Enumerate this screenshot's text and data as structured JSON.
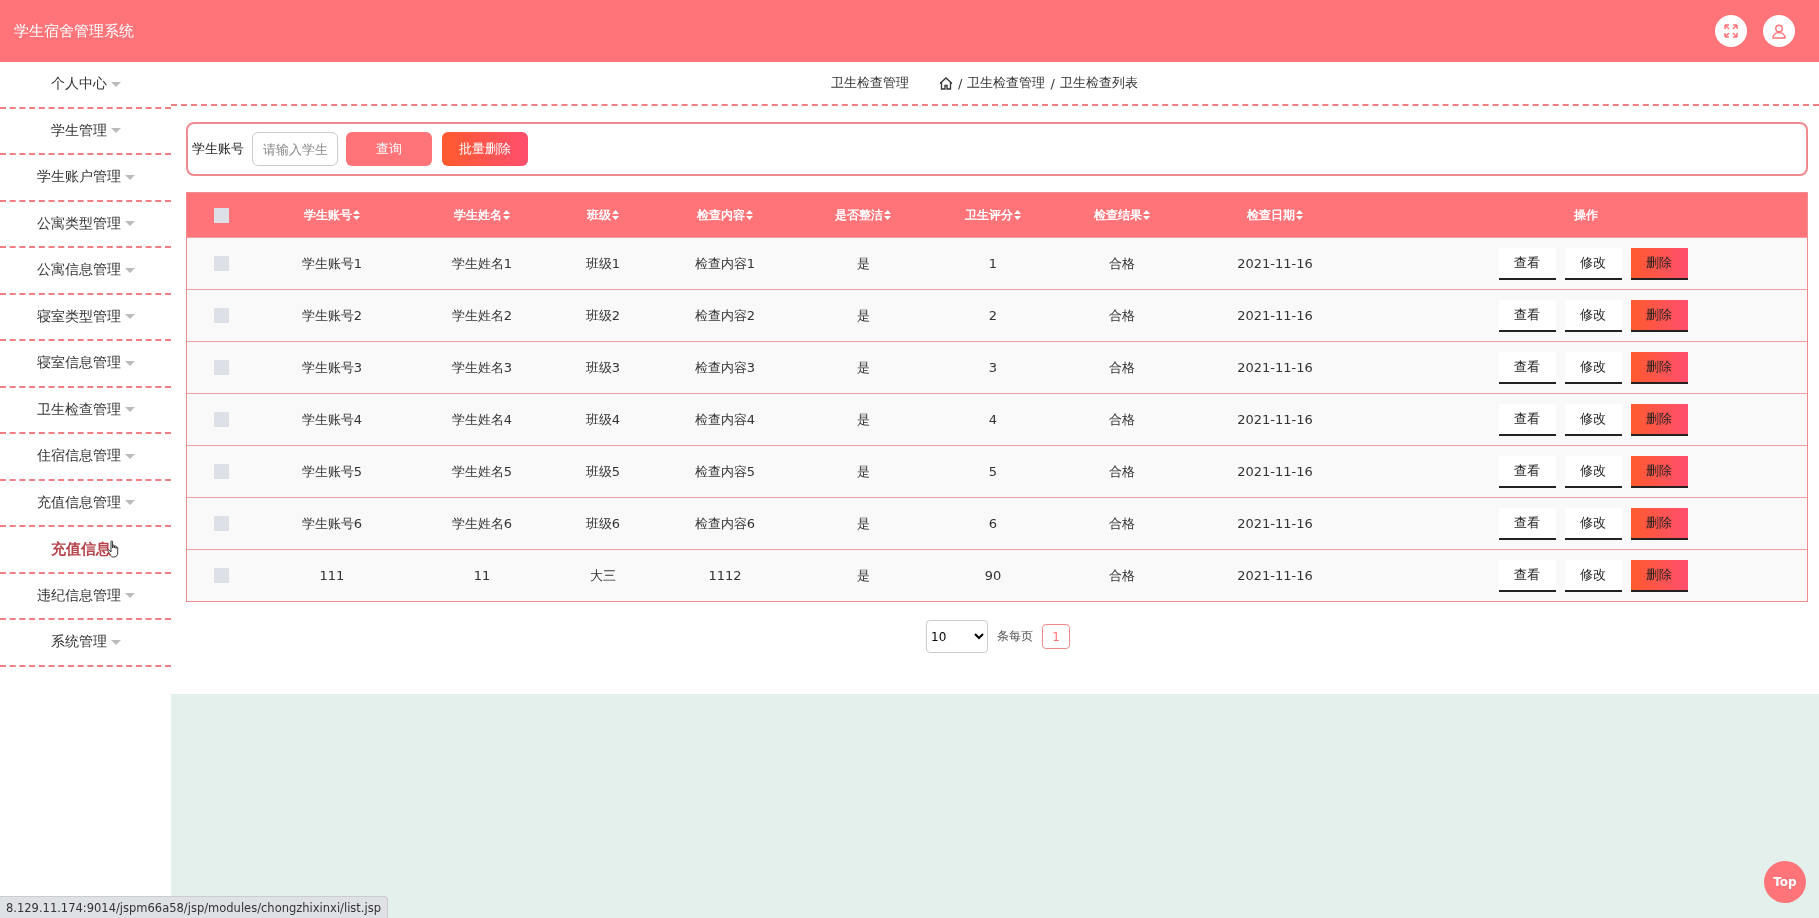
{
  "header": {
    "title": "学生宿舍管理系统"
  },
  "sidebar": {
    "items": [
      {
        "label": "个人中心"
      },
      {
        "label": "学生管理"
      },
      {
        "label": "学生账户管理"
      },
      {
        "label": "公寓类型管理"
      },
      {
        "label": "公寓信息管理"
      },
      {
        "label": "寝室类型管理"
      },
      {
        "label": "寝室信息管理"
      },
      {
        "label": "卫生检查管理"
      },
      {
        "label": "住宿信息管理"
      },
      {
        "label": "充值信息管理",
        "children": [
          {
            "label": "充值信息",
            "hovered": true
          }
        ]
      },
      {
        "label": "违纪信息管理"
      },
      {
        "label": "系统管理"
      }
    ]
  },
  "page_title": "卫生检查管理",
  "breadcrumb": {
    "separator": "/",
    "items": [
      "卫生检查管理",
      "卫生检查列表"
    ]
  },
  "search": {
    "label": "学生账号",
    "placeholder": "请输入学生",
    "buttons": [
      {
        "label": "查询",
        "kind": "query"
      },
      {
        "label": "批量删除",
        "kind": "danger"
      }
    ]
  },
  "table": {
    "select_all": {
      "checked": false
    },
    "columns": [
      "学生账号",
      "学生姓名",
      "班级",
      "检查内容",
      "是否整洁",
      "卫生评分",
      "检查结果",
      "检查日期"
    ],
    "actions_column": "操作",
    "rows": [
      {
        "checked": false,
        "cells": [
          "学生账号1",
          "学生姓名1",
          "班级1",
          "检查内容1",
          "是",
          "1",
          "合格",
          "2021-11-16"
        ],
        "actions": [
          "查看",
          "修改",
          "删除"
        ]
      },
      {
        "checked": false,
        "cells": [
          "学生账号2",
          "学生姓名2",
          "班级2",
          "检查内容2",
          "是",
          "2",
          "合格",
          "2021-11-16"
        ],
        "actions": [
          "查看",
          "修改",
          "删除"
        ]
      },
      {
        "checked": false,
        "cells": [
          "学生账号3",
          "学生姓名3",
          "班级3",
          "检查内容3",
          "是",
          "3",
          "合格",
          "2021-11-16"
        ],
        "actions": [
          "查看",
          "修改",
          "删除"
        ]
      },
      {
        "checked": false,
        "cells": [
          "学生账号4",
          "学生姓名4",
          "班级4",
          "检查内容4",
          "是",
          "4",
          "合格",
          "2021-11-16"
        ],
        "actions": [
          "查看",
          "修改",
          "删除"
        ]
      },
      {
        "checked": false,
        "cells": [
          "学生账号5",
          "学生姓名5",
          "班级5",
          "检查内容5",
          "是",
          "5",
          "合格",
          "2021-11-16"
        ],
        "actions": [
          "查看",
          "修改",
          "删除"
        ]
      },
      {
        "checked": false,
        "cells": [
          "学生账号6",
          "学生姓名6",
          "班级6",
          "检查内容6",
          "是",
          "6",
          "合格",
          "2021-11-16"
        ],
        "actions": [
          "查看",
          "修改",
          "删除"
        ]
      },
      {
        "checked": false,
        "cells": [
          "111",
          "11",
          "大三",
          "1112",
          "是",
          "90",
          "合格",
          "2021-11-16"
        ],
        "actions": [
          "查看",
          "修改",
          "删除"
        ]
      }
    ]
  },
  "pagination": {
    "page_size": "10",
    "per_page_label": "条每页",
    "pages": [
      {
        "label": "1",
        "selected": true
      }
    ]
  },
  "top_button": "Top",
  "status_bar": {
    "url": "8.129.11.174:9014/jspm66a58/jsp/modules/chongzhixinxi/list.jsp"
  }
}
